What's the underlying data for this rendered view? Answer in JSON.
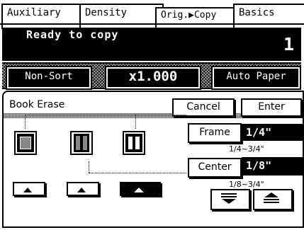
{
  "tabs": [
    {
      "label": "Auxiliary"
    },
    {
      "label": "Density"
    },
    {
      "label": "Orig.▶Copy"
    },
    {
      "label": "Basics"
    }
  ],
  "status": {
    "message": "Ready to copy",
    "copy_count": "1"
  },
  "settings": {
    "sort": "Non-Sort",
    "zoom": "x1.000",
    "paper": "Auto Paper"
  },
  "book_erase": {
    "title": "Book Erase",
    "cancel_label": "Cancel",
    "enter_label": "Enter",
    "frame_label": "Frame",
    "frame_value": "1/4\"",
    "frame_range": "1/4~3/4\"",
    "center_label": "Center",
    "center_value": "1/8\"",
    "center_range": "1/8~3/4\"",
    "selected_mode": 3
  }
}
